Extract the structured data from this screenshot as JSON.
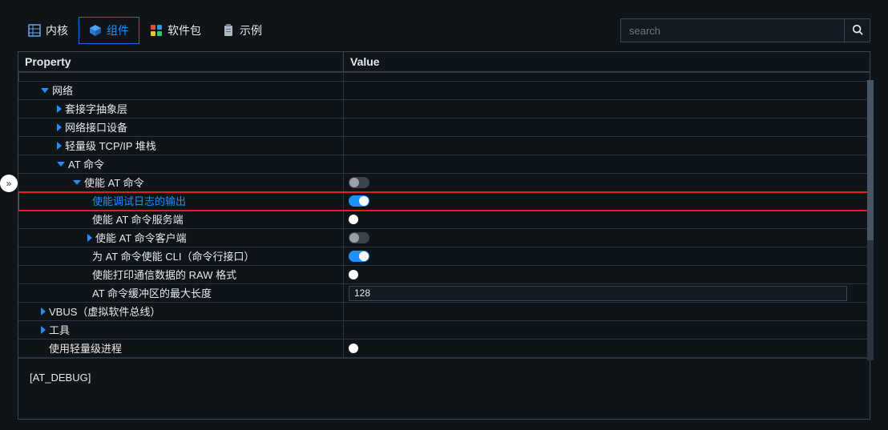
{
  "tabs": {
    "kernel": "内核",
    "components": "组件",
    "packages": "软件包",
    "examples": "示例"
  },
  "search": {
    "placeholder": "search"
  },
  "header": {
    "property": "Property",
    "value": "Value"
  },
  "tree": {
    "network": "网络",
    "socket_abs": "套接字抽象层",
    "net_if": "网络接口设备",
    "lwip": "轻量级 TCP/IP 堆栈",
    "at_cmd": "AT 命令",
    "enable_at": "使能 AT 命令",
    "enable_debug_log": "使能调试日志的输出",
    "enable_at_server": "使能 AT 命令服务端",
    "enable_at_client": "使能 AT 命令客户端",
    "enable_cli": "为 AT 命令使能 CLI（命令行接口）",
    "enable_raw": "使能打印通信数据的 RAW 格式",
    "buf_len": "AT 命令缓冲区的最大长度",
    "vbus": "VBUS（虚拟软件总线）",
    "tools": "工具",
    "lwp": "使用轻量级进程"
  },
  "values": {
    "buf_len": "128"
  },
  "desc": "[AT_DEBUG]"
}
